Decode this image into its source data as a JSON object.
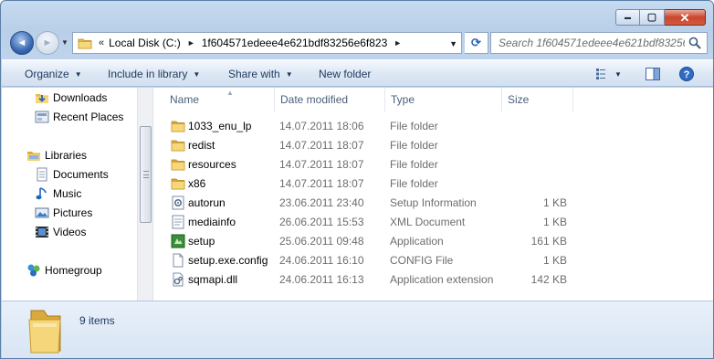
{
  "window": {
    "caption": {
      "minimize": "▬",
      "maximize": "▢",
      "close": "✕"
    }
  },
  "nav": {
    "back": "◄",
    "forward": "►",
    "address": {
      "overflow": "«",
      "crumbs": [
        "Local Disk (C:)",
        "1f604571edeee4e621bdf83256e6f823"
      ],
      "separator": "►"
    },
    "refresh": "⟳",
    "search_placeholder": "Search 1f604571edeee4e621bdf83256e..."
  },
  "commands": {
    "organize": "Organize",
    "include_in_library": "Include in library",
    "share_with": "Share with",
    "new_folder": "New folder"
  },
  "navpane": {
    "items": [
      {
        "label": "Downloads",
        "icon": "downloads-icon"
      },
      {
        "label": "Recent Places",
        "icon": "recent-places-icon"
      },
      {
        "label": "Libraries",
        "icon": "libraries-icon"
      },
      {
        "label": "Documents",
        "icon": "documents-icon"
      },
      {
        "label": "Music",
        "icon": "music-icon"
      },
      {
        "label": "Pictures",
        "icon": "pictures-icon"
      },
      {
        "label": "Videos",
        "icon": "videos-icon"
      },
      {
        "label": "Homegroup",
        "icon": "homegroup-icon"
      }
    ]
  },
  "columns": {
    "name": "Name",
    "date": "Date modified",
    "type": "Type",
    "size": "Size"
  },
  "files": [
    {
      "name": "1033_enu_lp",
      "date": "14.07.2011 18:06",
      "type": "File folder",
      "size": "",
      "icon": "folder-icon"
    },
    {
      "name": "redist",
      "date": "14.07.2011 18:07",
      "type": "File folder",
      "size": "",
      "icon": "folder-icon"
    },
    {
      "name": "resources",
      "date": "14.07.2011 18:07",
      "type": "File folder",
      "size": "",
      "icon": "folder-icon"
    },
    {
      "name": "x86",
      "date": "14.07.2011 18:07",
      "type": "File folder",
      "size": "",
      "icon": "folder-icon"
    },
    {
      "name": "autorun",
      "date": "23.06.2011 23:40",
      "type": "Setup Information",
      "size": "1 KB",
      "icon": "setup-info-icon"
    },
    {
      "name": "mediainfo",
      "date": "26.06.2011 15:53",
      "type": "XML Document",
      "size": "1 KB",
      "icon": "xml-icon"
    },
    {
      "name": "setup",
      "date": "25.06.2011 09:48",
      "type": "Application",
      "size": "161 KB",
      "icon": "application-icon"
    },
    {
      "name": "setup.exe.config",
      "date": "24.06.2011 16:10",
      "type": "CONFIG File",
      "size": "1 KB",
      "icon": "config-file-icon"
    },
    {
      "name": "sqmapi.dll",
      "date": "24.06.2011 16:13",
      "type": "Application extension",
      "size": "142 KB",
      "icon": "dll-icon"
    }
  ],
  "details": {
    "item_count": "9 items"
  }
}
